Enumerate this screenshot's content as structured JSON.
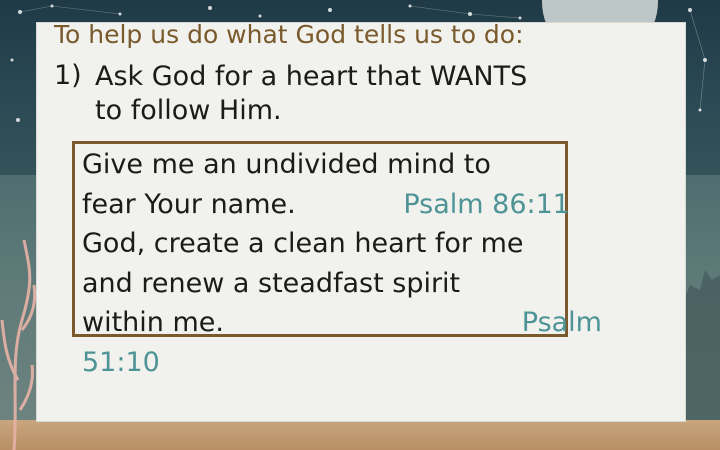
{
  "slide": {
    "heading": "To help us do what God tells us to do:",
    "item": {
      "number": "1)",
      "line1": "Ask God for a heart that WANTS",
      "line2": "to follow Him."
    },
    "verses": {
      "v1_line1": "Give me an undivided mind to",
      "v1_line2": "fear Your name.",
      "v1_ref": "Psalm 86:11",
      "v2_line1": "God, create a clean heart for me",
      "v2_line2": "and renew a steadfast spirit",
      "v2_line3": "within me.",
      "v2_ref_a": "Psalm",
      "v2_ref_b": "51:10"
    }
  },
  "colors": {
    "heading": "#7a5a2c",
    "body_text": "#1b1b1b",
    "reference": "#4e9396",
    "box_border": "#7a5a2c",
    "card": "#f1f1ee"
  }
}
